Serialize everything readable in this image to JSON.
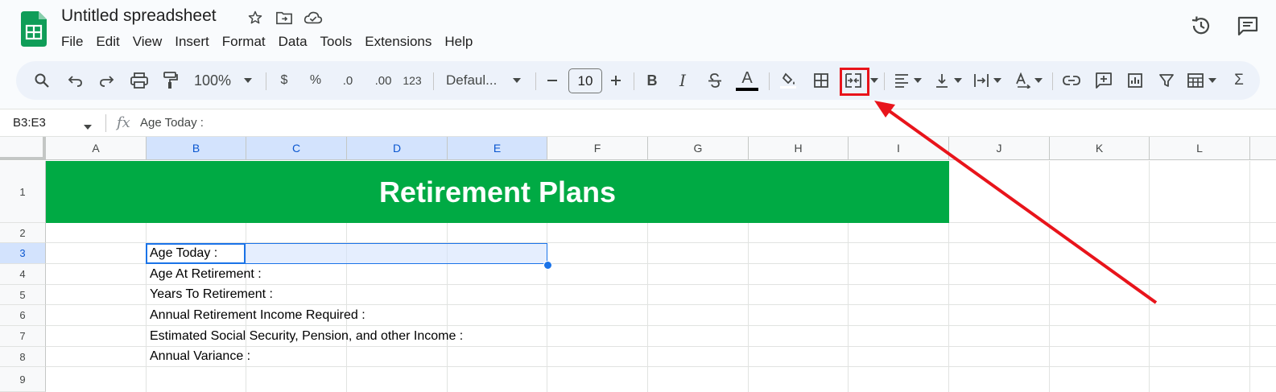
{
  "app": {
    "title": "Untitled spreadsheet",
    "menu": [
      "File",
      "Edit",
      "View",
      "Insert",
      "Format",
      "Data",
      "Tools",
      "Extensions",
      "Help"
    ]
  },
  "toolbar": {
    "zoom": "100%",
    "currency": "$",
    "percent": "%",
    "decrease_decimal": ".0",
    "increase_decimal": ".00",
    "number_format": "123",
    "font": "Defaul...",
    "font_size": "10",
    "bold": "B",
    "italic": "I",
    "text_color_letter": "A",
    "sum": "Σ"
  },
  "formula_bar": {
    "name_box": "B3:E3",
    "fx": "fx",
    "content": "Age Today :"
  },
  "sheet": {
    "columns": [
      "A",
      "B",
      "C",
      "D",
      "E",
      "F",
      "G",
      "H",
      "I",
      "J",
      "K",
      "L"
    ],
    "selected_columns": [
      "B",
      "C",
      "D",
      "E"
    ],
    "rows": [
      "1",
      "2",
      "3",
      "4",
      "5",
      "6",
      "7",
      "8",
      "9"
    ],
    "selected_row": "3",
    "banner": "Retirement Plans",
    "cells": {
      "B3": "Age Today :",
      "B4": "Age At Retirement :",
      "B5": "Years To Retirement :",
      "B6": "Annual Retirement Income Required :",
      "B7": "Estimated Social Security, Pension, and other Income :",
      "B8": "Annual Variance :"
    }
  },
  "colors": {
    "banner_bg": "#00aa44",
    "selection": "#1a73e8",
    "annotation": "#e8141b"
  },
  "icons": [
    "sheets-logo-icon",
    "star-icon",
    "move-folder-icon",
    "cloud-saved-icon",
    "history-icon",
    "comments-icon",
    "search-icon",
    "undo-icon",
    "redo-icon",
    "print-icon",
    "paint-format-icon",
    "strikethrough-icon",
    "fill-color-icon",
    "borders-icon",
    "merge-cells-icon",
    "align-left-icon",
    "valign-icon",
    "text-wrap-icon",
    "text-rotate-icon",
    "link-icon",
    "add-comment-icon",
    "chart-icon",
    "filter-icon",
    "table-icon"
  ]
}
